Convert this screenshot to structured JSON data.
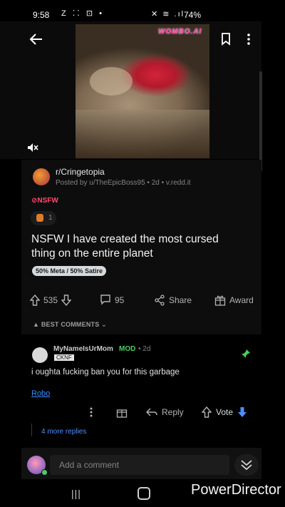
{
  "status_bar": {
    "time": "9:58",
    "left_icons": "Z ⁚⁚ ⊡ •",
    "right_icons": "✕ ≋ .ıl",
    "battery": "74%"
  },
  "video": {
    "watermark_logo": "WOMBO.AI"
  },
  "post": {
    "subreddit": "r/Cringetopia",
    "meta": "Posted by u/TheEpicBoss95 • 2d • v.redd.it",
    "nsfw_tag": "NSFW",
    "award_count": "1",
    "title": "NSFW I have created the most cursed thing on the entire planet",
    "flair": "50% Meta / 50% Satire",
    "vote_count": "535",
    "comment_count": "95",
    "share_label": "Share",
    "award_label": "Award"
  },
  "comments_header": {
    "sort_label": "BEST COMMENTS"
  },
  "comment": {
    "username": "MyNameIsUrMom",
    "mod_badge": "MOD",
    "time": "• 2d",
    "user_flair": "CKNF",
    "body": "i oughta fucking ban you for this garbage",
    "link_text": "Robo",
    "reply_label": "Reply",
    "vote_label": "Vote",
    "more_replies": "4 more replies"
  },
  "composer": {
    "placeholder": "Add a comment"
  },
  "overlay": {
    "watermark": "PowerDirector"
  },
  "colors": {
    "background": "#000000",
    "link_blue": "#3d8bff",
    "mod_green": "#46d160",
    "nsfw_red": "#ff4d6d",
    "vote_blue": "#4f8ff7"
  }
}
